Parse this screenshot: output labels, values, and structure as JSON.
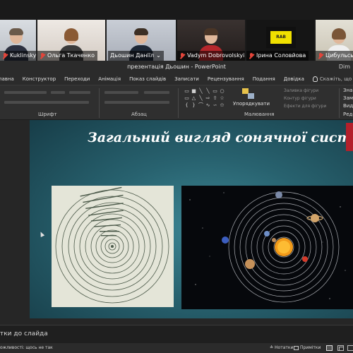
{
  "participants": [
    {
      "name": "Kuklinskyi",
      "muted": true
    },
    {
      "name": "Ольга Ткаченко",
      "muted": true
    },
    {
      "name": "Дьошин Даніїл",
      "muted": false,
      "active": true,
      "suffix": "⌄"
    },
    {
      "name": "Vadym Dobrovolskyi",
      "muted": true
    },
    {
      "name": "Ірина Соловйова",
      "muted": true,
      "logo_text": "RAB"
    },
    {
      "name": "Цибульськ",
      "muted": true
    }
  ],
  "window": {
    "title": "презентація Дьошин  -  PowerPoint",
    "title_right": "Dim"
  },
  "ribbon_tabs": [
    "лавна",
    "Конструктор",
    "Переходи",
    "Анімація",
    "Показ слайдів",
    "Записати",
    "Рецензування",
    "Подання",
    "Довідка"
  ],
  "tell_me": "Скажіть, що потрібно зробити",
  "ribbon": {
    "groups": [
      "Шрифт",
      "Абзац",
      "Малювання"
    ],
    "arrange_label": "Упорядкувати",
    "fill_options": [
      "Заливка фігури",
      "Контур фігури",
      "Ефекти для фігури"
    ],
    "right_menu": [
      "Знай",
      "Замі",
      "Виді",
      "Редаг"
    ]
  },
  "slide": {
    "title": "Загальний вигляд сонячної системи",
    "accent_color": "#b3202b"
  },
  "notes": {
    "placeholder": "тки до слайда"
  },
  "status": {
    "accessibility": "ожливості: щось не так",
    "notes_btn": "Нотатки",
    "comments_btn": "Примітки"
  }
}
